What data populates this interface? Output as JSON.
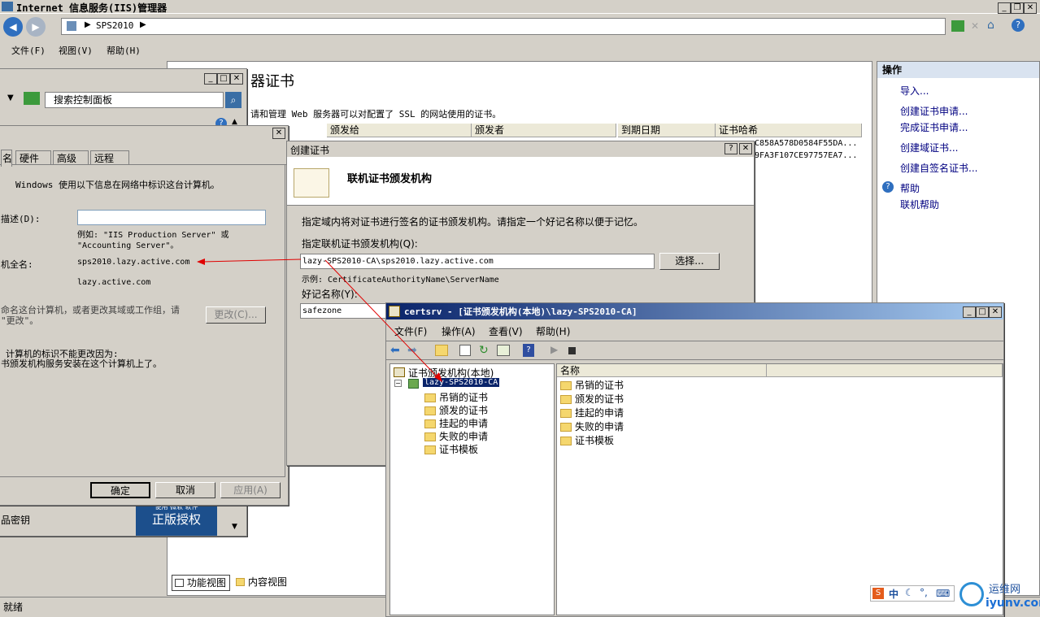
{
  "iis": {
    "title": "Internet 信息服务(IIS)管理器",
    "address": "SPS2010",
    "menu": [
      "文件(F)",
      "视图(V)",
      "帮助(H)"
    ],
    "section_title": "器证书",
    "description": "请和管理 Web 服务器可以对配置了 SSL 的网站使用的证书。",
    "columns": [
      "颁发给",
      "颁发者",
      "到期日期",
      "证书哈希"
    ],
    "hashes": [
      "C858A578D0584F55DA...",
      "9FA3F107CE97757EA7..."
    ],
    "actions_header": "操作",
    "actions": [
      "导入...",
      "创建证书申请...",
      "完成证书申请...",
      "创建域证书...",
      "创建自签名证书..."
    ],
    "help_items": [
      "帮助",
      "联机帮助"
    ],
    "view_tabs": [
      "功能视图",
      "内容视图"
    ],
    "status": "就绪"
  },
  "cpanel": {
    "search": "搜索控制面板"
  },
  "sysprop": {
    "tabs": [
      "名",
      "硬件",
      "高级",
      "远程"
    ],
    "intro": "Windows 使用以下信息在网络中标识这台计算机。",
    "desc_label": "描述(D):",
    "example": "例如: \"IIS Production Server\" 或 \"Accounting Server\"。",
    "fullname_label": "机全名:",
    "fullname": "sps2010.lazy.active.com",
    "domain": "lazy.active.com",
    "rename_text": "命名这台计算机，或者更改其域或工作组，请 \"更改\"。",
    "change_btn": "更改(C)...",
    "cannot_change": "计算机的标识不能更改因为:",
    "reason": "书颁发机构服务安装在这个计算机上了。",
    "ok": "确定",
    "cancel": "取消",
    "apply": "应用(A)",
    "product_key": "品密钥",
    "banner": "正版授权",
    "banner_top": "使用 微软 软件"
  },
  "wizard": {
    "title": "创建证书",
    "heading": "联机证书颁发机构",
    "instruction": "指定域内将对证书进行签名的证书颁发机构。请指定一个好记名称以便于记忆。",
    "ca_label": "指定联机证书颁发机构(Q):",
    "ca_value": "lazy-SPS2010-CA\\sps2010.lazy.active.com",
    "select_btn": "选择...",
    "example": "示例: CertificateAuthorityName\\ServerName",
    "friendly_label": "好记名称(Y):",
    "friendly_value": "safezone"
  },
  "certsrv": {
    "title": "certsrv - [证书颁发机构(本地)\\lazy-SPS2010-CA]",
    "menu": [
      "文件(F)",
      "操作(A)",
      "查看(V)",
      "帮助(H)"
    ],
    "root": "证书颁发机构(本地)",
    "ca": "lazy-SPS2010-CA",
    "tree": [
      "吊销的证书",
      "颁发的证书",
      "挂起的申请",
      "失败的申请",
      "证书模板"
    ],
    "col_name": "名称",
    "list": [
      "吊销的证书",
      "颁发的证书",
      "挂起的申请",
      "失败的申请",
      "证书模板"
    ]
  },
  "tray": {
    "ime": "中",
    "site_name": "运维网",
    "site_url": "iyunv.com"
  }
}
